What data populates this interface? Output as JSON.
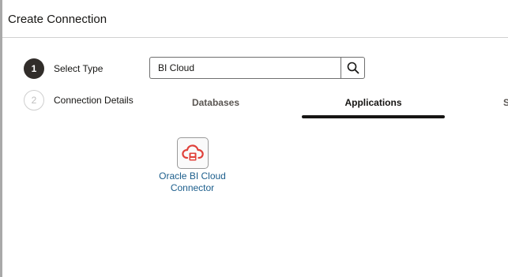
{
  "dialog": {
    "title": "Create Connection"
  },
  "steps": [
    {
      "number": "1",
      "label": "Select Type",
      "state": "active"
    },
    {
      "number": "2",
      "label": "Connection Details",
      "state": "inactive"
    }
  ],
  "search": {
    "value": "BI Cloud",
    "button_icon": "search-icon"
  },
  "tabs": [
    {
      "label": "Databases",
      "selected": false
    },
    {
      "label": "Applications",
      "selected": true
    },
    {
      "label": "S",
      "selected": false
    }
  ],
  "results": [
    {
      "label_line1": "Oracle BI Cloud",
      "label_line2": "Connector",
      "icon": "cloud-connector-icon",
      "icon_color": "#e0413a"
    }
  ],
  "colors": {
    "accent": "#161513",
    "link": "#1c5e8c",
    "icon_red": "#e0413a"
  }
}
